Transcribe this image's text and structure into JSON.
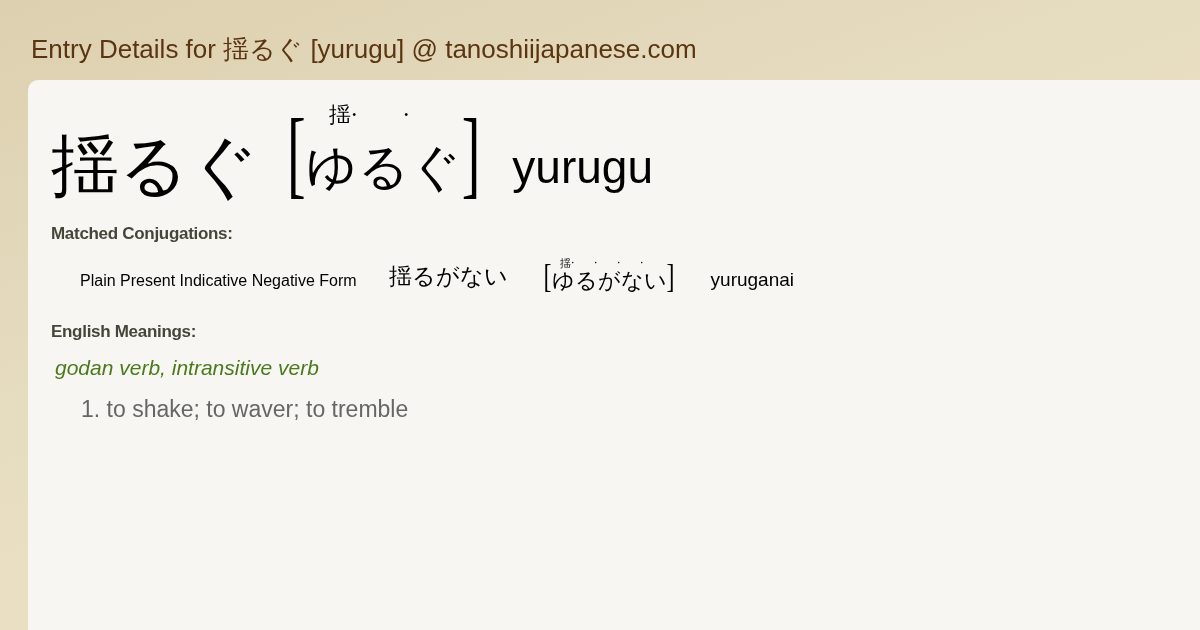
{
  "page_title": "Entry Details for 揺るぐ [yurugu] @ tanoshiijapanese.com",
  "entry": {
    "word": "揺るぐ",
    "reading": {
      "open": "[",
      "close": "]",
      "parts": [
        {
          "kana": "ゆ",
          "mark": "揺·"
        },
        {
          "kana": "る",
          "mark": "·"
        },
        {
          "kana": "ぐ"
        }
      ]
    },
    "romaji": "yurugu"
  },
  "conjugations": {
    "heading": "Matched Conjugations:",
    "items": [
      {
        "form": "Plain Present Indicative Negative Form",
        "word": "揺るがない",
        "reading": {
          "open": "[",
          "close": "]",
          "parts": [
            {
              "kana": "ゆ",
              "mark": "揺·"
            },
            {
              "kana": "る",
              "mark": "·"
            },
            {
              "kana": "が",
              "mark": "·"
            },
            {
              "kana": "な",
              "mark": "·"
            },
            {
              "kana": "い"
            }
          ]
        },
        "romaji": "yuruganai"
      }
    ]
  },
  "meanings": {
    "heading": "English Meanings:",
    "part_of_speech": "godan verb, intransitive verb",
    "senses": [
      "1. to shake; to waver; to tremble"
    ]
  }
}
